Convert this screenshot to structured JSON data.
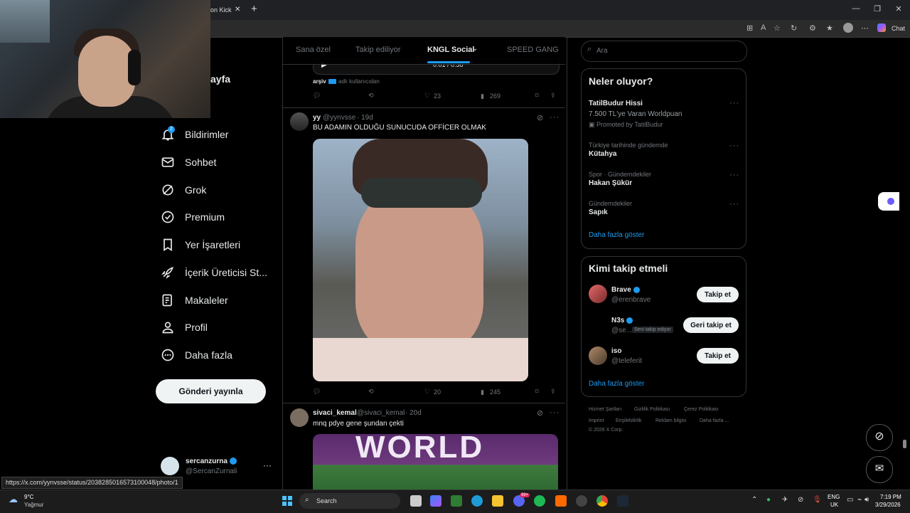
{
  "browser": {
    "tab_title": "on Kick",
    "close_tab": "✕",
    "new_tab": "+",
    "chat_label": "Chat",
    "status_url": "https://x.com/yynvsse/status/2038285016573100048/photo/1"
  },
  "nav": {
    "page_partial": "ayfa",
    "notif_count": "2",
    "items": [
      {
        "label": "Bildirimler"
      },
      {
        "label": "Sohbet"
      },
      {
        "label": "Grok"
      },
      {
        "label": "Premium"
      },
      {
        "label": "Yer İşaretleri"
      },
      {
        "label": "İçerik Üreticisi St..."
      },
      {
        "label": "Makaleler"
      },
      {
        "label": "Profil"
      },
      {
        "label": "Daha fazla"
      }
    ],
    "post_button": "Gönderi yayınla",
    "account": {
      "name": "sercanzurna",
      "handle": "@SercanZurnali"
    }
  },
  "tabs": [
    "Sana özel",
    "Takip ediliyor",
    "KNGL Social",
    "SPEED GANG"
  ],
  "feed": {
    "prev_post": {
      "video_time": "0:01 / 0:38",
      "source_user": "arşiv",
      "source_suffix": "adlı kullanıcıdan",
      "likes": "23",
      "views": "269"
    },
    "post1": {
      "name": "yy",
      "handle": "@yynvsse",
      "time": "· 19d",
      "text": "BU ADAMIN OLDUĞU SUNUCUDA OFFİCER OLMAK",
      "likes": "20",
      "views": "245"
    },
    "post2": {
      "name": "sivaci_kemal",
      "handle": "@sivaci_kemal",
      "time": "· 20d",
      "text": "mnq pdye gene şundan çekti",
      "image_text": "WORLD"
    }
  },
  "search": {
    "placeholder": "Ara"
  },
  "trends": {
    "title": "Neler oluyor?",
    "promo": {
      "title": "TatilBudur Hissi",
      "desc": "7.500 TL'ye Varan Worldpuan",
      "promoted": "Promoted by TatilBudur"
    },
    "items": [
      {
        "context": "Türkiye tarihinde gündemde",
        "name": "Kütahya"
      },
      {
        "context": "Spor · Gündemdekiler",
        "name": "Hakan Şükür"
      },
      {
        "context": "Gündemdekiler",
        "name": "Sapık"
      }
    ],
    "show_more": "Daha fazla göster"
  },
  "who_to_follow": {
    "title": "Kimi takip etmeli",
    "users": [
      {
        "name": "Brave",
        "handle": "@erenbrave",
        "button": "Takip et",
        "badge": ""
      },
      {
        "name": "N3s",
        "handle": "@se...",
        "button": "Geri takip et",
        "badge": "Seni takip ediyor"
      },
      {
        "name": "iso",
        "handle": "@teleferit",
        "button": "Takip et",
        "badge": ""
      }
    ],
    "show_more": "Daha fazla göster"
  },
  "footer": {
    "links": [
      "Hizmet Şartları",
      "Gizlilik Politikası",
      "Çerez Politikası",
      "Imprint",
      "Erişilebilirlik",
      "Reklam bilgisi",
      "Daha fazla ..."
    ],
    "copyright": "© 2026 X Corp."
  },
  "taskbar": {
    "weather_temp": "9°C",
    "weather_desc": "Yağmur",
    "search": "Search",
    "lang1": "ENG",
    "lang2": "UK",
    "time": "7:19 PM",
    "date": "3/29/2026",
    "discord_badge": "99+"
  },
  "colors": {
    "accent": "#1d9bf0",
    "background": "#000000",
    "border": "#2f3336"
  }
}
